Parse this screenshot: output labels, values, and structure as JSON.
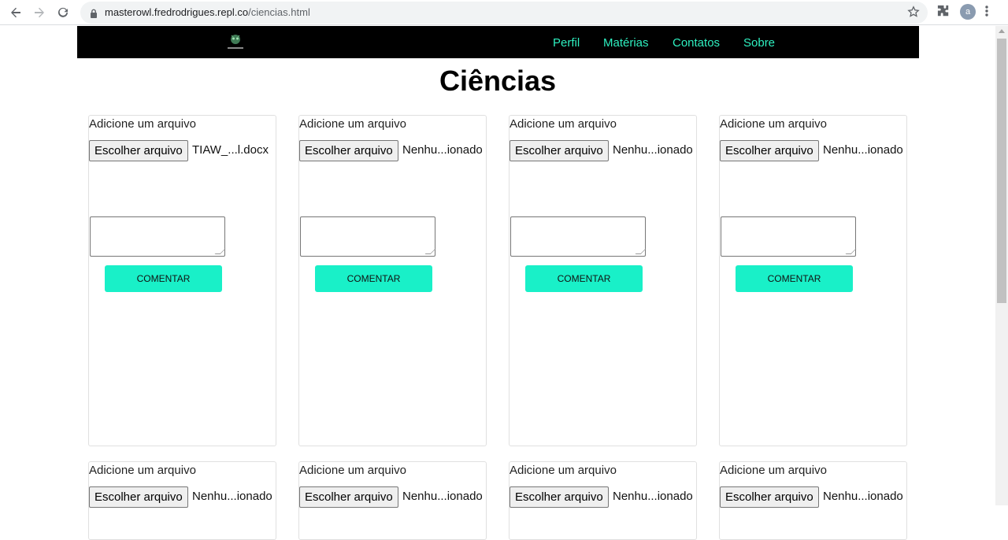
{
  "browser": {
    "url_host": "masterowl.fredrodrigues.repl.co",
    "url_path": "/ciencias.html",
    "avatar_letter": "a",
    "icons": [
      "back-icon",
      "forward-icon",
      "reload-icon",
      "lock-icon",
      "star-icon",
      "extensions-icon",
      "menu-icon"
    ]
  },
  "site": {
    "logo_text": "masterowl",
    "nav": [
      "Perfil",
      "Matérias",
      "Contatos",
      "Sobre"
    ],
    "accent": "#2ef0c0",
    "button_color": "#19f0c8"
  },
  "page": {
    "title": "Ciências"
  },
  "cards": [
    {
      "label": "Adicione um arquivo",
      "file_button": "Escolher arquivo",
      "file_name": "TIAW_...l.docx",
      "comment_button": "COMENTAR"
    },
    {
      "label": "Adicione um arquivo",
      "file_button": "Escolher arquivo",
      "file_name": "Nenhu...ionado",
      "comment_button": "COMENTAR"
    },
    {
      "label": "Adicione um arquivo",
      "file_button": "Escolher arquivo",
      "file_name": "Nenhu...ionado",
      "comment_button": "COMENTAR"
    },
    {
      "label": "Adicione um arquivo",
      "file_button": "Escolher arquivo",
      "file_name": "Nenhu...ionado",
      "comment_button": "COMENTAR"
    },
    {
      "label": "Adicione um arquivo",
      "file_button": "Escolher arquivo",
      "file_name": "Nenhu...ionado"
    },
    {
      "label": "Adicione um arquivo",
      "file_button": "Escolher arquivo",
      "file_name": "Nenhu...ionado"
    },
    {
      "label": "Adicione um arquivo",
      "file_button": "Escolher arquivo",
      "file_name": "Nenhu...ionado"
    },
    {
      "label": "Adicione um arquivo",
      "file_button": "Escolher arquivo",
      "file_name": "Nenhu...ionado"
    }
  ]
}
